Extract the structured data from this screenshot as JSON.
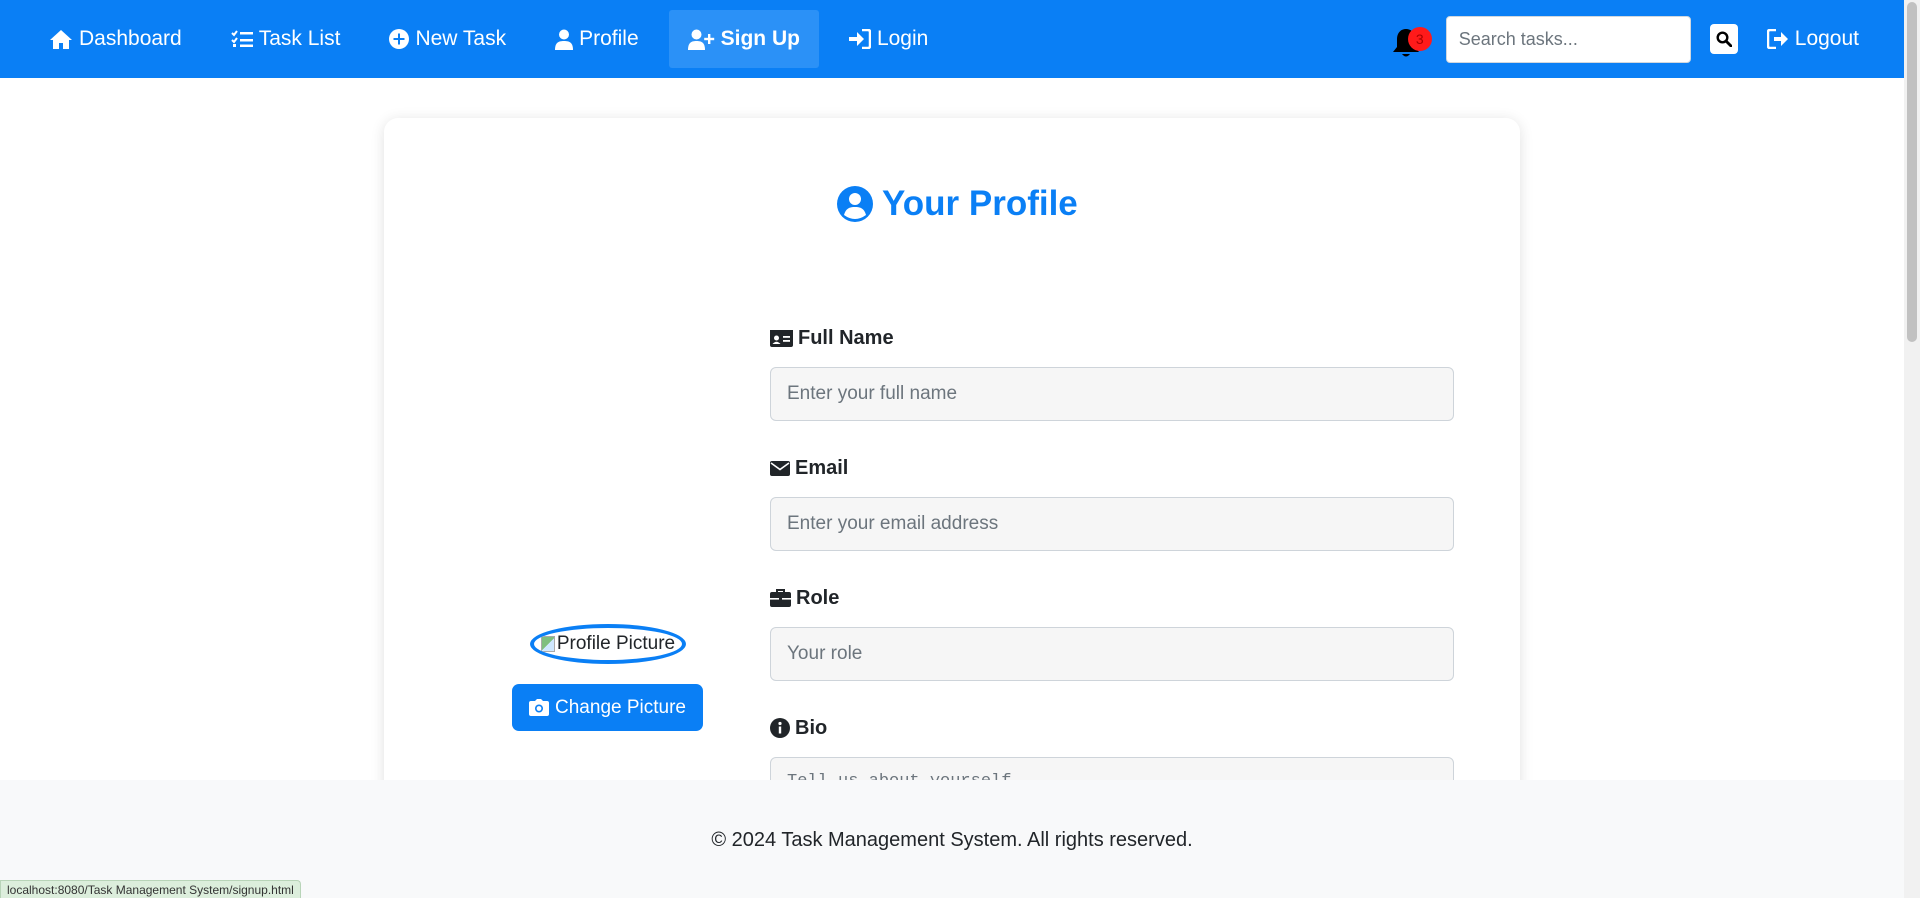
{
  "nav": {
    "items": [
      {
        "label": "Dashboard",
        "icon": "home-icon"
      },
      {
        "label": "Task List",
        "icon": "list-check-icon"
      },
      {
        "label": "New Task",
        "icon": "plus-circle-icon"
      },
      {
        "label": "Profile",
        "icon": "user-icon"
      },
      {
        "label": "Sign Up",
        "icon": "user-plus-icon",
        "active": true
      },
      {
        "label": "Login",
        "icon": "sign-in-icon"
      }
    ],
    "notification_count": "3",
    "search_placeholder": "Search tasks...",
    "logout_label": "Logout"
  },
  "profile": {
    "title": "Your Profile",
    "avatar_alt": "Profile Picture",
    "change_picture_label": "Change Picture",
    "fields": {
      "full_name": {
        "label": "Full Name",
        "placeholder": "Enter your full name",
        "icon": "id-card-icon"
      },
      "email": {
        "label": "Email",
        "placeholder": "Enter your email address",
        "icon": "envelope-icon"
      },
      "role": {
        "label": "Role",
        "placeholder": "Your role",
        "icon": "briefcase-icon"
      },
      "bio": {
        "label": "Bio",
        "placeholder": "Tell us about yourself",
        "icon": "info-circle-icon"
      }
    }
  },
  "footer": {
    "text": "© 2024 Task Management System. All rights reserved."
  },
  "status_bar": {
    "url": "localhost:8080/Task Management System/signup.html"
  },
  "colors": {
    "primary": "#0a7ff5",
    "active_nav": "#2b91f7",
    "badge": "#ff1a1a",
    "footer_bg": "#f8f9fa"
  }
}
